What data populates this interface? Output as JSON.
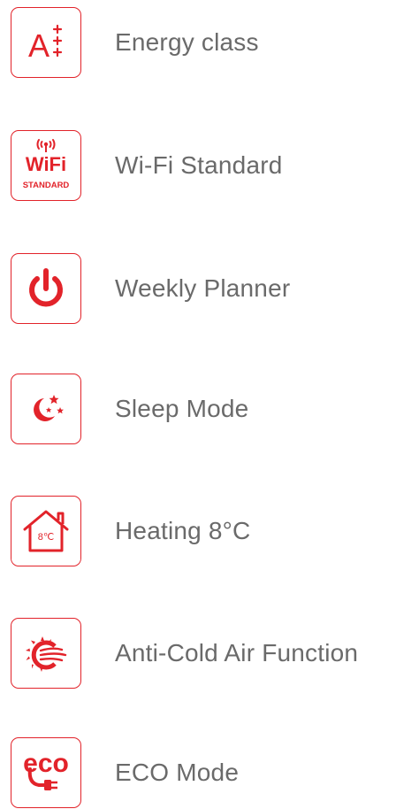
{
  "features": [
    {
      "label": "Energy class",
      "icon": "energy-class-a-plus-plus-plus-icon",
      "icon_text": "A"
    },
    {
      "label": "Wi-Fi Standard",
      "icon": "wifi-standard-icon",
      "icon_text": "WiFi",
      "icon_subtext": "STANDARD"
    },
    {
      "label": "Weekly Planner",
      "icon": "power-icon"
    },
    {
      "label": "Sleep Mode",
      "icon": "moon-stars-icon"
    },
    {
      "label": "Heating  8°C",
      "icon": "house-8c-icon",
      "icon_text": "8℃"
    },
    {
      "label": "Anti-Cold Air Function",
      "icon": "sun-wind-icon"
    },
    {
      "label": "ECO Mode",
      "icon": "eco-plug-icon",
      "icon_text": "eco"
    }
  ],
  "colors": {
    "accent": "#e2232a",
    "label_text": "#6a6a6a",
    "background": "#ffffff"
  }
}
